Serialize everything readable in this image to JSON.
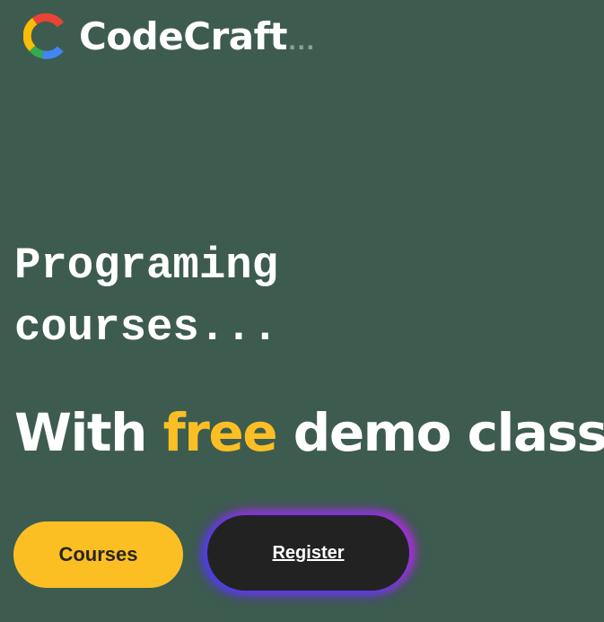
{
  "header": {
    "logo_icon": "codecraft-c-logo-icon",
    "brand_name": "CodeCraft",
    "brand_dots": "...",
    "logo_colors": {
      "red": "#ea4335",
      "yellow": "#fbbc05",
      "green": "#34a853",
      "blue": "#4285f4"
    }
  },
  "hero": {
    "headline_line1": "Programing",
    "headline_line2": "courses...",
    "subheadline_prefix": "With",
    "subheadline_accent": "free",
    "subheadline_suffix": "demo class"
  },
  "actions": {
    "courses_label": "Courses",
    "register_label": "Register"
  },
  "colors": {
    "background": "#3d5c4f",
    "accent": "#fbbf24",
    "register_bg": "#222222"
  }
}
